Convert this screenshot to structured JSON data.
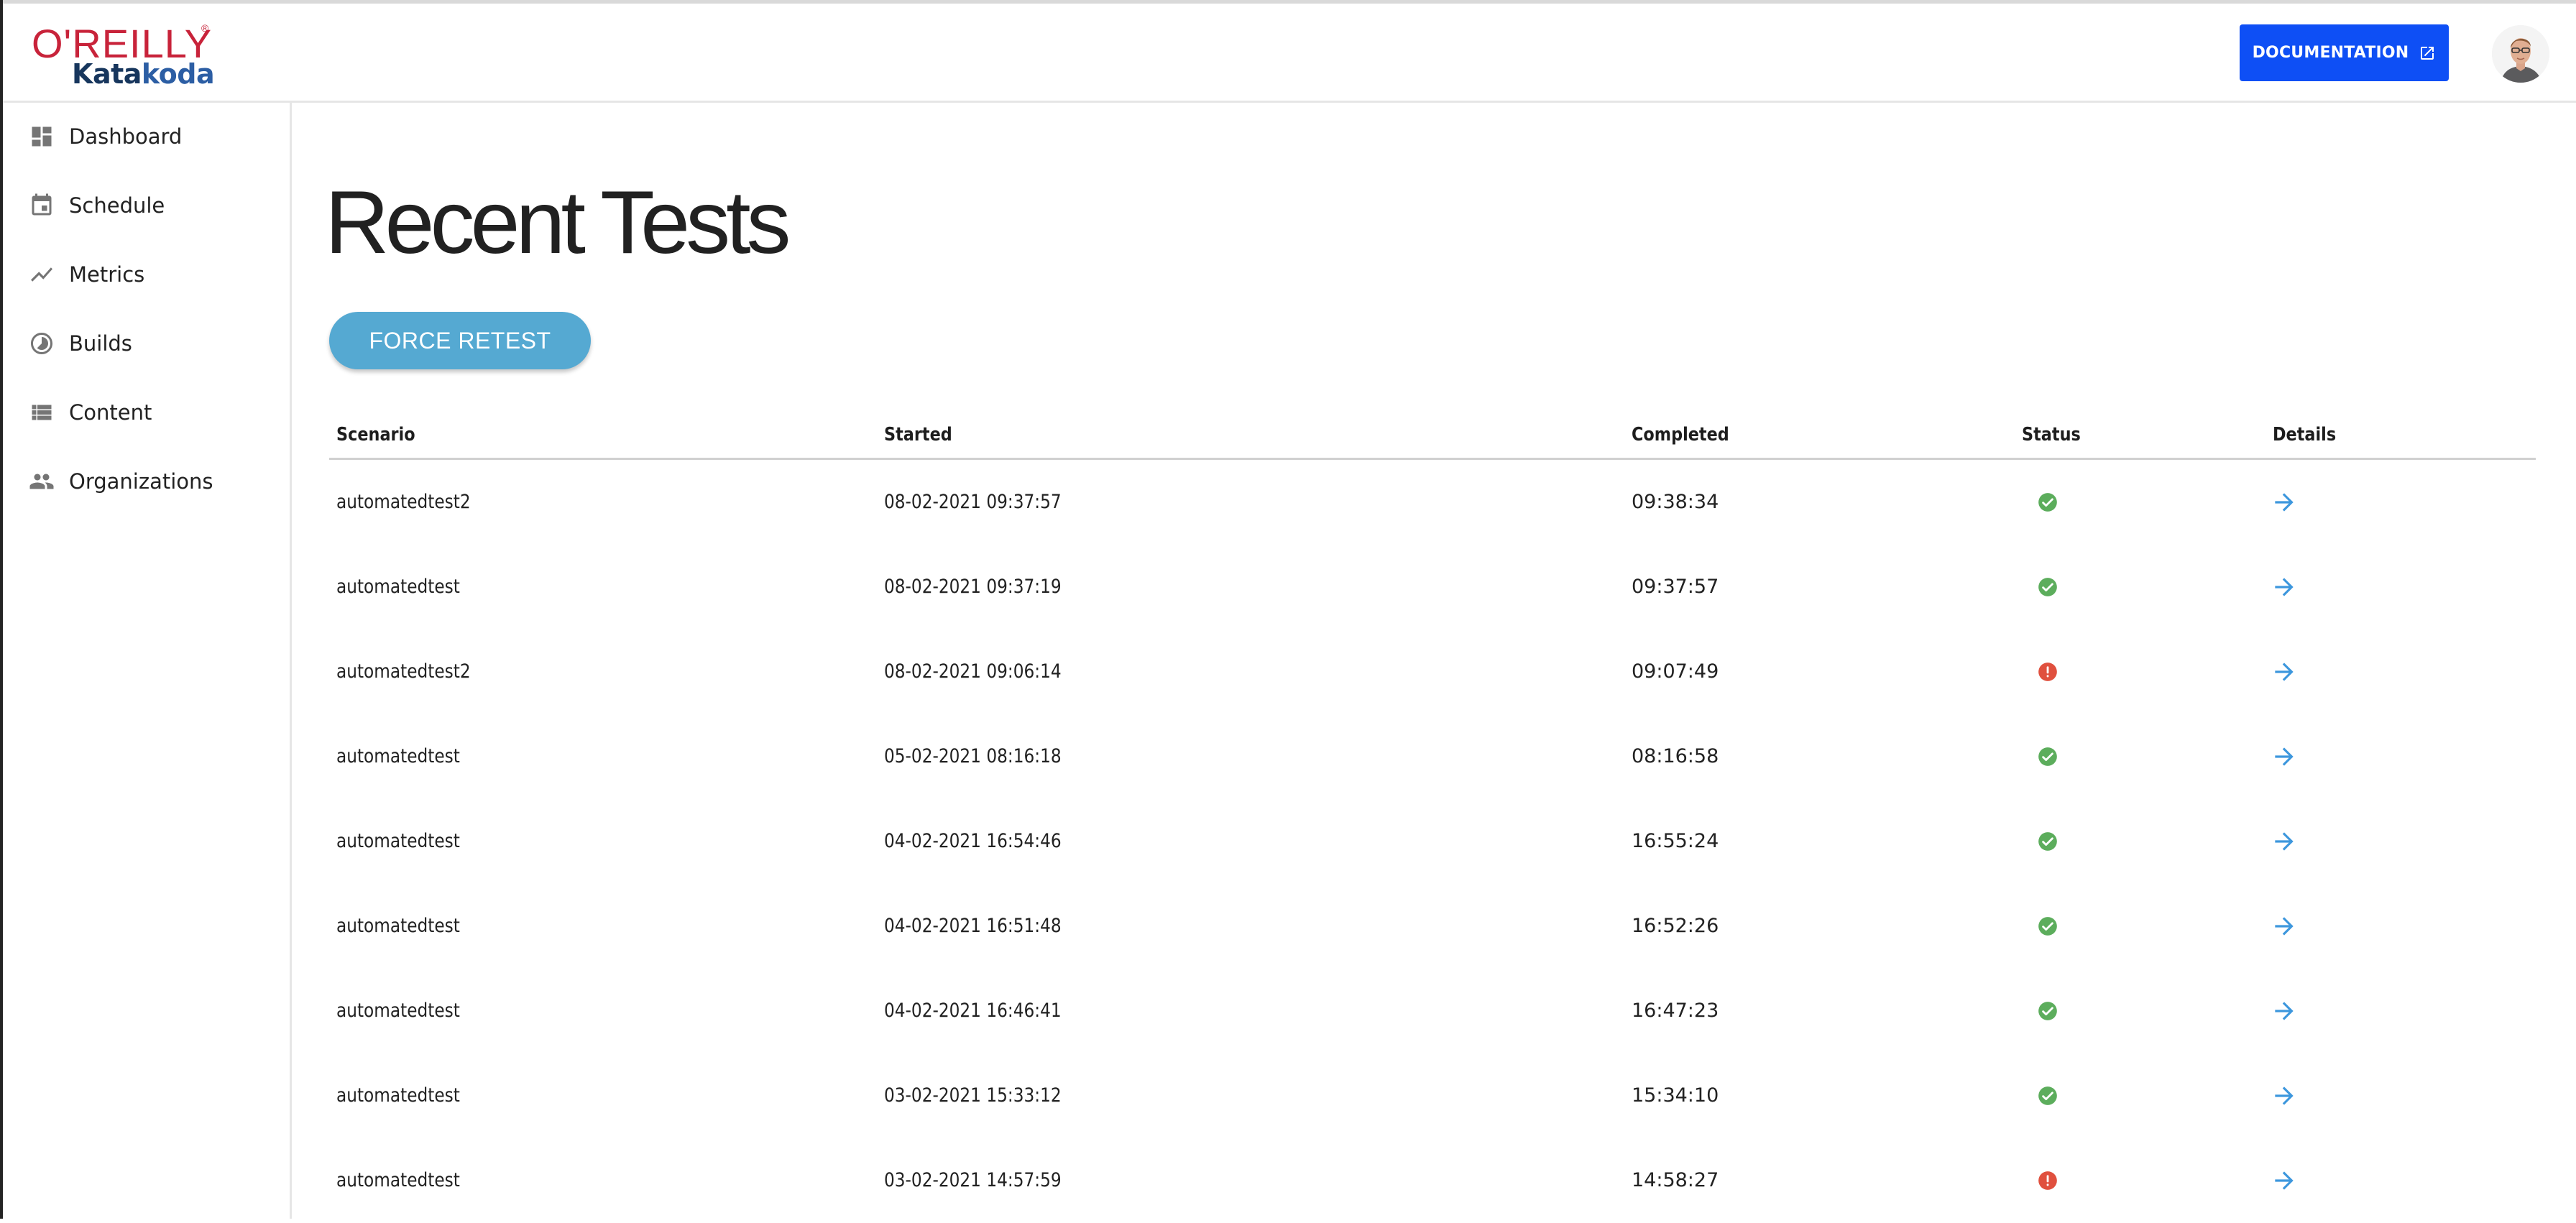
{
  "header": {
    "logo": {
      "brand": "O'REILLY",
      "registered": "®",
      "product_part1": "Kata",
      "product_part2": "koda"
    },
    "documentation_button": {
      "label": "DOCUMENTATION",
      "icon": "external-link-icon"
    },
    "avatar": {
      "icon": "user-avatar"
    }
  },
  "sidebar": {
    "items": [
      {
        "label": "Dashboard",
        "icon": "dashboard-icon"
      },
      {
        "label": "Schedule",
        "icon": "calendar-icon"
      },
      {
        "label": "Metrics",
        "icon": "trending-line-icon"
      },
      {
        "label": "Builds",
        "icon": "timelapse-icon"
      },
      {
        "label": "Content",
        "icon": "list-icon"
      },
      {
        "label": "Organizations",
        "icon": "people-icon"
      }
    ]
  },
  "main": {
    "title": "Recent Tests",
    "force_retest_label": "FORCE RETEST",
    "table": {
      "columns": [
        "Scenario",
        "Started",
        "Completed",
        "Status",
        "Details"
      ],
      "rows": [
        {
          "scenario": "automatedtest2",
          "started": "08-02-2021 09:37:57",
          "completed": "09:38:34",
          "status": "success"
        },
        {
          "scenario": "automatedtest",
          "started": "08-02-2021 09:37:19",
          "completed": "09:37:57",
          "status": "success"
        },
        {
          "scenario": "automatedtest2",
          "started": "08-02-2021 09:06:14",
          "completed": "09:07:49",
          "status": "error"
        },
        {
          "scenario": "automatedtest",
          "started": "05-02-2021 08:16:18",
          "completed": "08:16:58",
          "status": "success"
        },
        {
          "scenario": "automatedtest",
          "started": "04-02-2021 16:54:46",
          "completed": "16:55:24",
          "status": "success"
        },
        {
          "scenario": "automatedtest",
          "started": "04-02-2021 16:51:48",
          "completed": "16:52:26",
          "status": "success"
        },
        {
          "scenario": "automatedtest",
          "started": "04-02-2021 16:46:41",
          "completed": "16:47:23",
          "status": "success"
        },
        {
          "scenario": "automatedtest",
          "started": "03-02-2021 15:33:12",
          "completed": "15:34:10",
          "status": "success"
        },
        {
          "scenario": "automatedtest",
          "started": "03-02-2021 14:57:59",
          "completed": "14:58:27",
          "status": "error"
        }
      ]
    }
  },
  "colors": {
    "brand_red": "#c8233a",
    "brand_navy": "#17365d",
    "documentation_blue": "#0e4ff5",
    "retest_blue": "#55a9d2",
    "success_green": "#5cad5c",
    "error_red": "#e0503e",
    "details_arrow_blue": "#3d97dd"
  }
}
